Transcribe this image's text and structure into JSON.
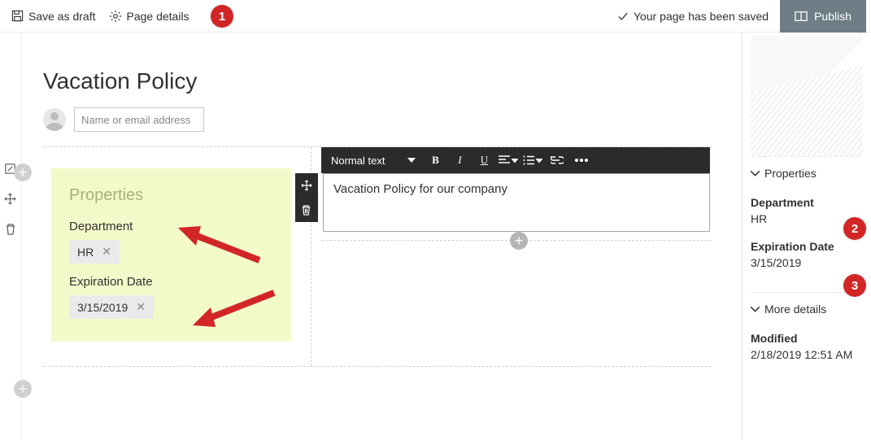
{
  "cmdbar": {
    "save_draft": "Save as draft",
    "page_details": "Page details",
    "saved_msg": "Your page has been saved",
    "publish": "Publish"
  },
  "page": {
    "title": "Vacation Policy",
    "author_placeholder": "Name or email address"
  },
  "props_webpart": {
    "title": "Properties",
    "department_label": "Department",
    "department_value": "HR",
    "expiration_label": "Expiration Date",
    "expiration_value": "3/15/2019"
  },
  "rte": {
    "style_selector": "Normal text",
    "content": "Vacation Policy for our company"
  },
  "rightpanel": {
    "properties_header": "Properties",
    "department_label": "Department",
    "department_value": "HR",
    "expiration_label": "Expiration Date",
    "expiration_value": "3/15/2019",
    "more_details_header": "More details",
    "modified_label": "Modified",
    "modified_value": "2/18/2019 12:51 AM"
  },
  "annotations": {
    "b1": "1",
    "b2": "2",
    "b3": "3"
  }
}
